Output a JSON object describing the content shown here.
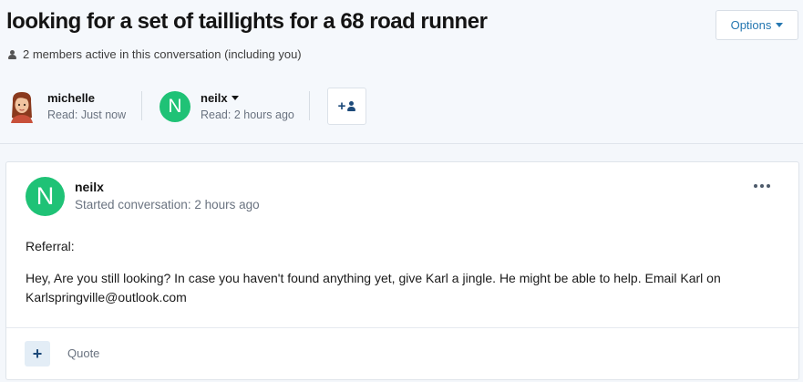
{
  "thread": {
    "title": "looking for a set of taillights for a 68 road runner",
    "options_label": "Options",
    "active_text": "2 members active in this conversation (including you)"
  },
  "participants": [
    {
      "name": "michelle",
      "read": "Read: Just now"
    },
    {
      "name": "neilx",
      "read": "Read: 2 hours ago",
      "avatar_letter": "N"
    }
  ],
  "message": {
    "author": "neilx",
    "avatar_letter": "N",
    "started": "Started conversation: 2 hours ago",
    "paragraphs": [
      "Referral:",
      "Hey, Are you still looking? In case you haven't found anything yet, give Karl a jingle.  He might be able to help. Email Karl on Karlspringville@outlook.com"
    ]
  },
  "footer": {
    "plus_label": "+",
    "quote_label": "Quote"
  },
  "colors": {
    "avatar_green": "#1fc276",
    "link_blue": "#2577b1",
    "dark_blue": "#1d4a7a"
  },
  "icons": {
    "active": "user-icon",
    "add_participant": "add-user-icon",
    "more": "ellipsis-icon"
  }
}
